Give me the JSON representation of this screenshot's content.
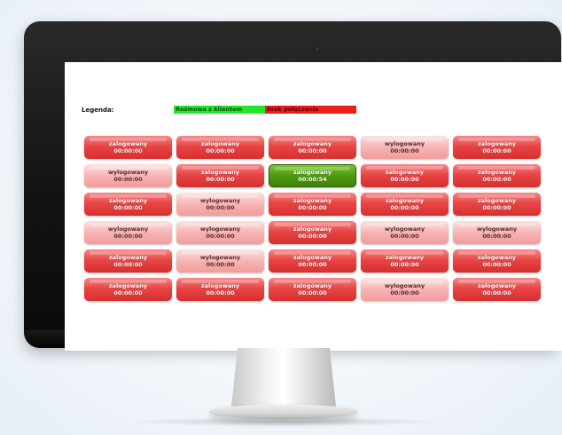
{
  "legend": {
    "label": "Legenda:",
    "items": [
      {
        "text": "Rozmowa z klientem",
        "color": "#22e62a"
      },
      {
        "text": "Brak połączenia",
        "color": "#ee1d1d"
      }
    ]
  },
  "agents": [
    {
      "status": "zalogowany",
      "time": "00:00:00",
      "state": "logged-in"
    },
    {
      "status": "zalogowany",
      "time": "00:00:00",
      "state": "logged-in"
    },
    {
      "status": "zalogowany",
      "time": "00:00:00",
      "state": "logged-in"
    },
    {
      "status": "wylogowany",
      "time": "00:00:00",
      "state": "logged-out"
    },
    {
      "status": "zalogowany",
      "time": "00:00:00",
      "state": "logged-in"
    },
    {
      "status": "wylogowany",
      "time": "00:00:00",
      "state": "logged-out"
    },
    {
      "status": "zalogowany",
      "time": "00:00:00",
      "state": "logged-in"
    },
    {
      "status": "zalogowany",
      "time": "00:00:54",
      "state": "talking"
    },
    {
      "status": "zalogowany",
      "time": "00:00:00",
      "state": "logged-in"
    },
    {
      "status": "zalogowany",
      "time": "00:00:00",
      "state": "logged-in"
    },
    {
      "status": "zalogowany",
      "time": "00:00:00",
      "state": "logged-in"
    },
    {
      "status": "wylogowany",
      "time": "00:00:00",
      "state": "logged-out"
    },
    {
      "status": "zalogowany",
      "time": "00:00:00",
      "state": "logged-in"
    },
    {
      "status": "zalogowany",
      "time": "00:00:00",
      "state": "logged-in"
    },
    {
      "status": "zalogowany",
      "time": "00:00:00",
      "state": "logged-in"
    },
    {
      "status": "wylogowany",
      "time": "00:00:00",
      "state": "logged-out"
    },
    {
      "status": "wylogowany",
      "time": "00:00:00",
      "state": "logged-out"
    },
    {
      "status": "zalogowany",
      "time": "00:00:00",
      "state": "logged-in"
    },
    {
      "status": "wylogowany",
      "time": "00:00:00",
      "state": "logged-out"
    },
    {
      "status": "wylogowany",
      "time": "00:00:00",
      "state": "logged-out"
    },
    {
      "status": "zalogowany",
      "time": "00:00:00",
      "state": "logged-in"
    },
    {
      "status": "wylogowany",
      "time": "00:00:00",
      "state": "logged-out"
    },
    {
      "status": "zalogowany",
      "time": "00:00:00",
      "state": "logged-in"
    },
    {
      "status": "zalogowany",
      "time": "00:00:00",
      "state": "logged-in"
    },
    {
      "status": "zalogowany",
      "time": "00:00:00",
      "state": "logged-in"
    },
    {
      "status": "zalogowany",
      "time": "00:00:00",
      "state": "logged-in"
    },
    {
      "status": "zalogowany",
      "time": "00:00:00",
      "state": "logged-in"
    },
    {
      "status": "zalogowany",
      "time": "00:00:00",
      "state": "logged-in"
    },
    {
      "status": "wylogowany",
      "time": "00:00:00",
      "state": "logged-out"
    },
    {
      "status": "zalogowany",
      "time": "00:00:00",
      "state": "logged-in"
    }
  ]
}
